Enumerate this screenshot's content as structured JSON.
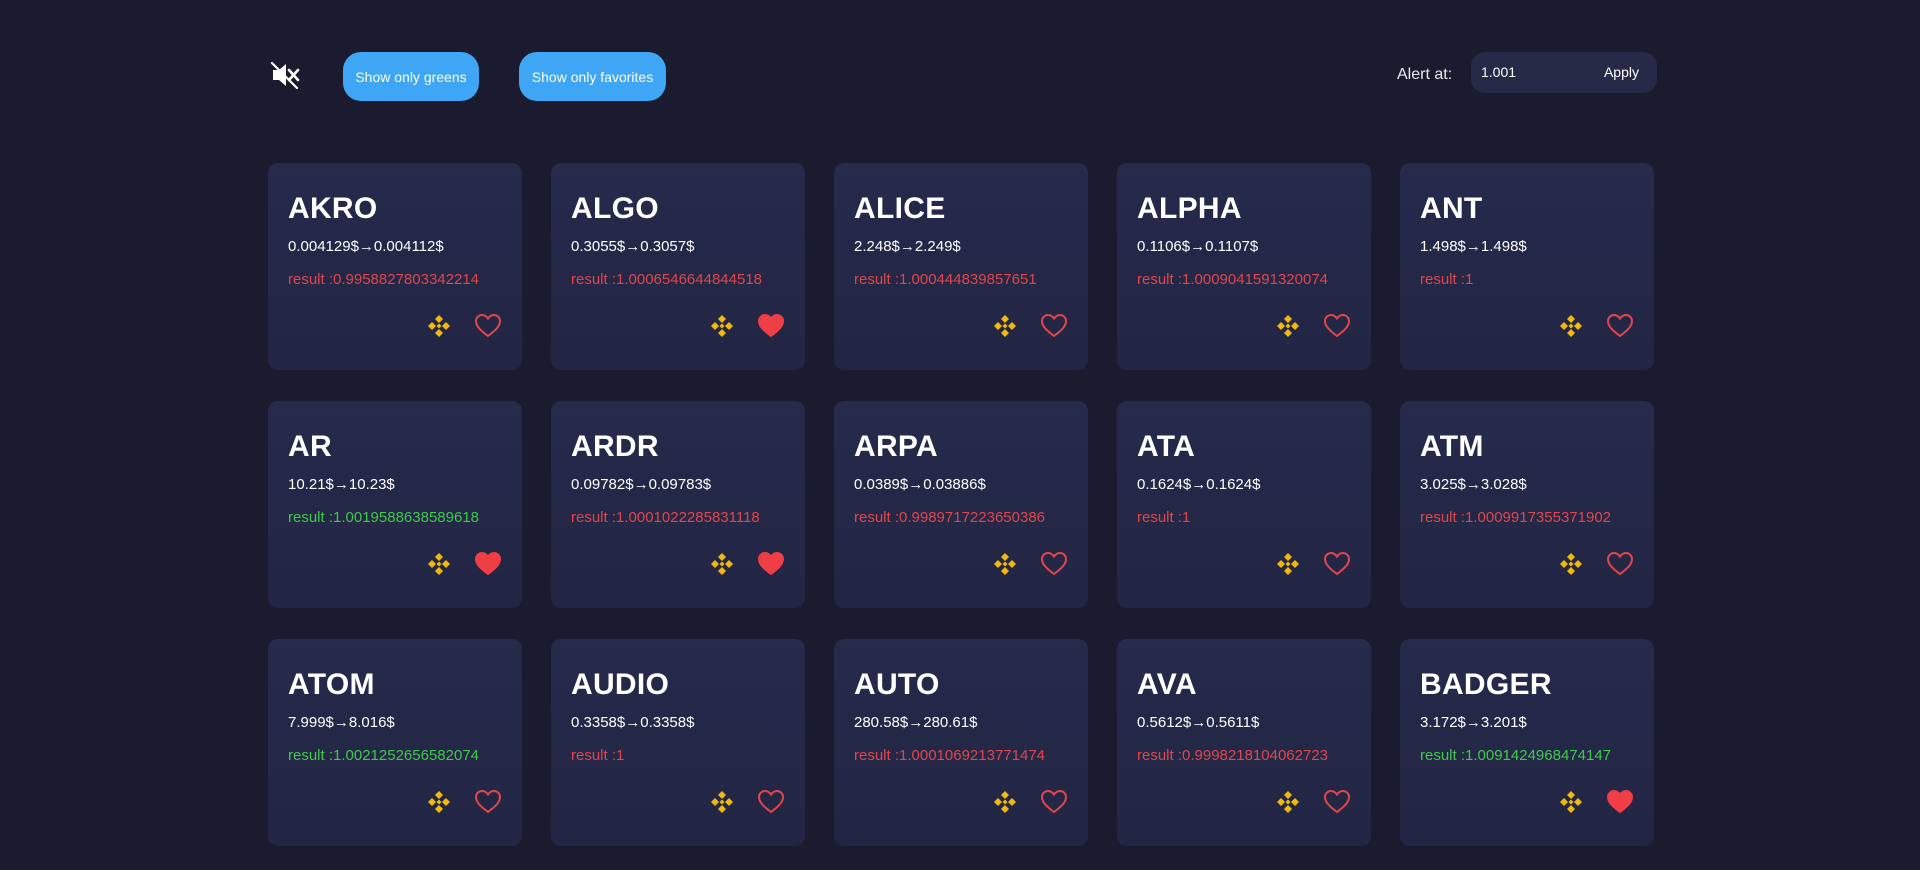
{
  "toolbar": {
    "mute_icon": "speaker-muted-icon",
    "greens_label": "Show only greens",
    "favorites_label": "Show only favorites",
    "alert_label": "Alert at:",
    "alert_value": "1.001",
    "apply_label": "Apply"
  },
  "colors": {
    "background": "#1a1b2e",
    "card": "#262a4b",
    "button": "#3ea6f5",
    "red": "#e0474c",
    "green": "#3fca48",
    "binance": "#f0b90b"
  },
  "cards": [
    {
      "symbol": "AKRO",
      "prices": "0.004129$→0.004112$",
      "result": "result :0.9958827803342214",
      "status": "red",
      "favorite": false
    },
    {
      "symbol": "ALGO",
      "prices": "0.3055$→0.3057$",
      "result": "result :1.0006546644844518",
      "status": "red",
      "favorite": true
    },
    {
      "symbol": "ALICE",
      "prices": "2.248$→2.249$",
      "result": "result :1.000444839857651",
      "status": "red",
      "favorite": false
    },
    {
      "symbol": "ALPHA",
      "prices": "0.1106$→0.1107$",
      "result": "result :1.0009041591320074",
      "status": "red",
      "favorite": false
    },
    {
      "symbol": "ANT",
      "prices": "1.498$→1.498$",
      "result": "result :1",
      "status": "red",
      "favorite": false
    },
    {
      "symbol": "AR",
      "prices": "10.21$→10.23$",
      "result": "result :1.0019588638589618",
      "status": "green",
      "favorite": true
    },
    {
      "symbol": "ARDR",
      "prices": "0.09782$→0.09783$",
      "result": "result :1.0001022285831118",
      "status": "red",
      "favorite": true
    },
    {
      "symbol": "ARPA",
      "prices": "0.0389$→0.03886$",
      "result": "result :0.9989717223650386",
      "status": "red",
      "favorite": false
    },
    {
      "symbol": "ATA",
      "prices": "0.1624$→0.1624$",
      "result": "result :1",
      "status": "red",
      "favorite": false
    },
    {
      "symbol": "ATM",
      "prices": "3.025$→3.028$",
      "result": "result :1.0009917355371902",
      "status": "red",
      "favorite": false
    },
    {
      "symbol": "ATOM",
      "prices": "7.999$→8.016$",
      "result": "result :1.0021252656582074",
      "status": "green",
      "favorite": false
    },
    {
      "symbol": "AUDIO",
      "prices": "0.3358$→0.3358$",
      "result": "result :1",
      "status": "red",
      "favorite": false
    },
    {
      "symbol": "AUTO",
      "prices": "280.58$→280.61$",
      "result": "result :1.0001069213771474",
      "status": "red",
      "favorite": false
    },
    {
      "symbol": "AVA",
      "prices": "0.5612$→0.5611$",
      "result": "result :0.9998218104062723",
      "status": "red",
      "favorite": false
    },
    {
      "symbol": "BADGER",
      "prices": "3.172$→3.201$",
      "result": "result :1.0091424968474147",
      "status": "green",
      "favorite": true
    }
  ]
}
